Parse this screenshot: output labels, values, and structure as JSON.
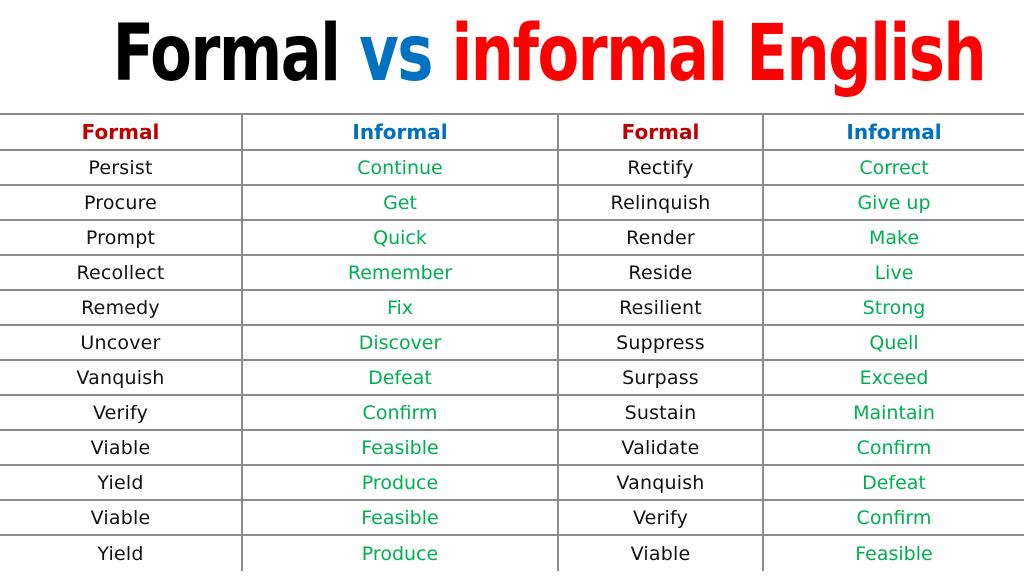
{
  "title": {
    "part1": "Formal",
    "part2": "vs",
    "part3": "informal English",
    "colors": {
      "part1": "#000000",
      "part2": "#0070C0",
      "part3": "#FF0000"
    }
  },
  "table": {
    "headers": [
      "Formal",
      "Informal",
      "Formal",
      "Informal"
    ],
    "header_colors": {
      "formal": "#C00000",
      "informal": "#0070C0"
    },
    "word_colors": {
      "formal": "#111111",
      "informal": "#00B050"
    },
    "rows": [
      [
        "Persist",
        "Continue",
        "Rectify",
        "Correct"
      ],
      [
        "Procure",
        "Get",
        "Relinquish",
        "Give up"
      ],
      [
        "Prompt",
        "Quick",
        "Render",
        "Make"
      ],
      [
        "Recollect",
        "Remember",
        "Reside",
        "Live"
      ],
      [
        "Remedy",
        "Fix",
        "Resilient",
        "Strong"
      ],
      [
        "Uncover",
        "Discover",
        "Suppress",
        "Quell"
      ],
      [
        "Vanquish",
        "Defeat",
        "Surpass",
        "Exceed"
      ],
      [
        "Verify",
        "Confirm",
        "Sustain",
        "Maintain"
      ],
      [
        "Viable",
        "Feasible",
        "Validate",
        "Confirm"
      ],
      [
        "Yield",
        "Produce",
        "Vanquish",
        "Defeat"
      ],
      [
        "Viable",
        "Feasible",
        "Verify",
        "Confirm"
      ],
      [
        "Yield",
        "Produce",
        "Viable",
        "Feasible"
      ]
    ]
  }
}
